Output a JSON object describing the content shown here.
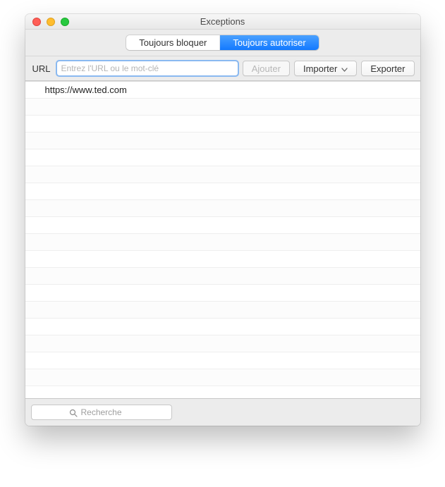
{
  "window": {
    "title": "Exceptions"
  },
  "tabs": {
    "block": "Toujours bloquer",
    "allow": "Toujours autoriser"
  },
  "toolbar": {
    "url_label": "URL",
    "url_placeholder": "Entrez l'URL ou le mot-clé",
    "add_label": "Ajouter",
    "import_label": "Importer",
    "export_label": "Exporter"
  },
  "list": {
    "items": [
      "https://www.ted.com"
    ]
  },
  "footer": {
    "search_placeholder": "Recherche"
  }
}
